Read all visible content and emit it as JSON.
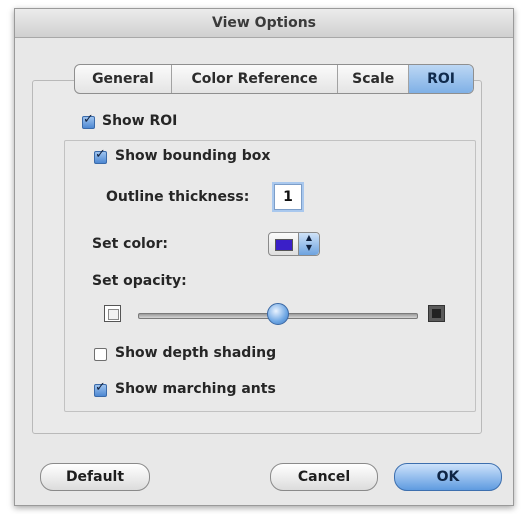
{
  "window": {
    "title": "View Options"
  },
  "tabs": [
    {
      "label": "General",
      "active": false
    },
    {
      "label": "Color Reference",
      "active": false
    },
    {
      "label": "Scale",
      "active": false
    },
    {
      "label": "ROI",
      "active": true
    }
  ],
  "roi": {
    "show_roi": {
      "label": "Show ROI",
      "checked": true
    },
    "show_bounding_box": {
      "label": "Show bounding box",
      "checked": true
    },
    "outline_thickness": {
      "label": "Outline thickness:",
      "value": "1"
    },
    "set_color": {
      "label": "Set color:",
      "color": "#3a1fc8"
    },
    "set_opacity": {
      "label": "Set opacity:",
      "value_fraction": 0.5
    },
    "show_depth_shading": {
      "label": "Show depth shading",
      "checked": false
    },
    "show_marching_ants": {
      "label": "Show marching ants",
      "checked": true
    }
  },
  "buttons": {
    "default": "Default",
    "cancel": "Cancel",
    "ok": "OK"
  },
  "colors": {
    "accent": "#6ea3df",
    "window_bg": "#e8e8e8"
  }
}
